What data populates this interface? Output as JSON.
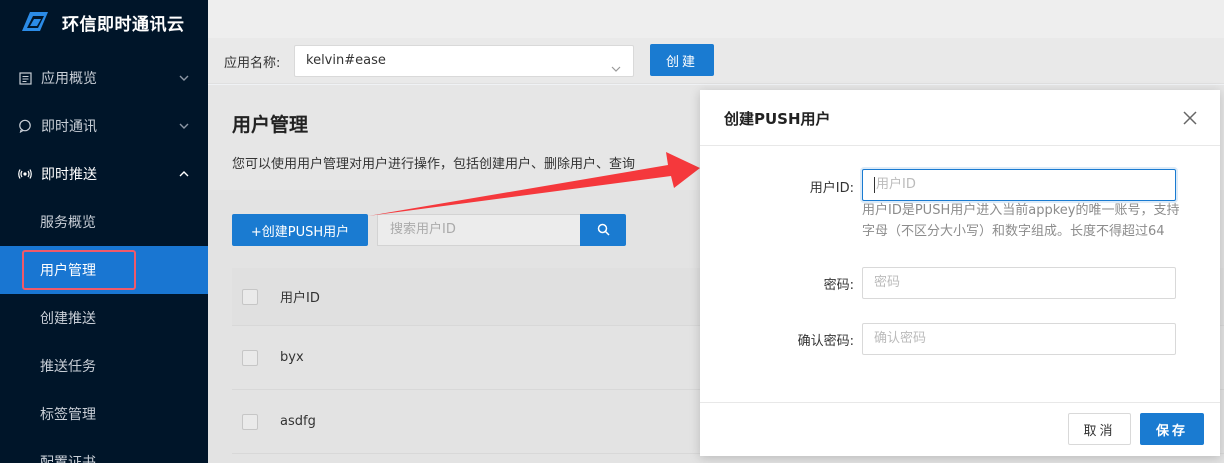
{
  "sidebar": {
    "logo_title": "环信即时通讯云",
    "menu": [
      {
        "label": "应用概览",
        "icon": "document-icon"
      },
      {
        "label": "即时通讯",
        "icon": "chat-icon"
      },
      {
        "label": "即时推送",
        "icon": "push-icon"
      }
    ],
    "submenu": [
      {
        "label": "服务概览"
      },
      {
        "label": "用户管理"
      },
      {
        "label": "创建推送"
      },
      {
        "label": "推送任务"
      },
      {
        "label": "标签管理"
      },
      {
        "label": "配置证书"
      }
    ]
  },
  "appbar": {
    "app_label": "应用名称:",
    "app_value": "kelvin#ease",
    "create_label": "创建"
  },
  "main": {
    "title": "用户管理",
    "desc": "您可以使用用户管理对用户进行操作，包括创建用户、删除用户、查询",
    "add_user_label": "+创建PUSH用户",
    "search_placeholder": "搜索用户ID",
    "table": {
      "header": "用户ID",
      "rows": [
        "byx",
        "asdfg"
      ]
    }
  },
  "modal": {
    "title": "创建PUSH用户",
    "user_id_label": "用户ID:",
    "user_id_placeholder": "用户ID",
    "help": "用户ID是PUSH用户进入当前appkey的唯一账号，支持字母（不区分大小写）和数字组成。长度不得超过64",
    "password_label": "密码:",
    "password_placeholder": "密码",
    "confirm_label": "确认密码:",
    "confirm_placeholder": "确认密码",
    "cancel_label": "取消",
    "save_label": "保存"
  },
  "colors": {
    "sidebar_bg": "#001529",
    "primary": "#1a7bd1",
    "highlight_border": "#f05a6a",
    "annotation_arrow": "#f5383c"
  }
}
